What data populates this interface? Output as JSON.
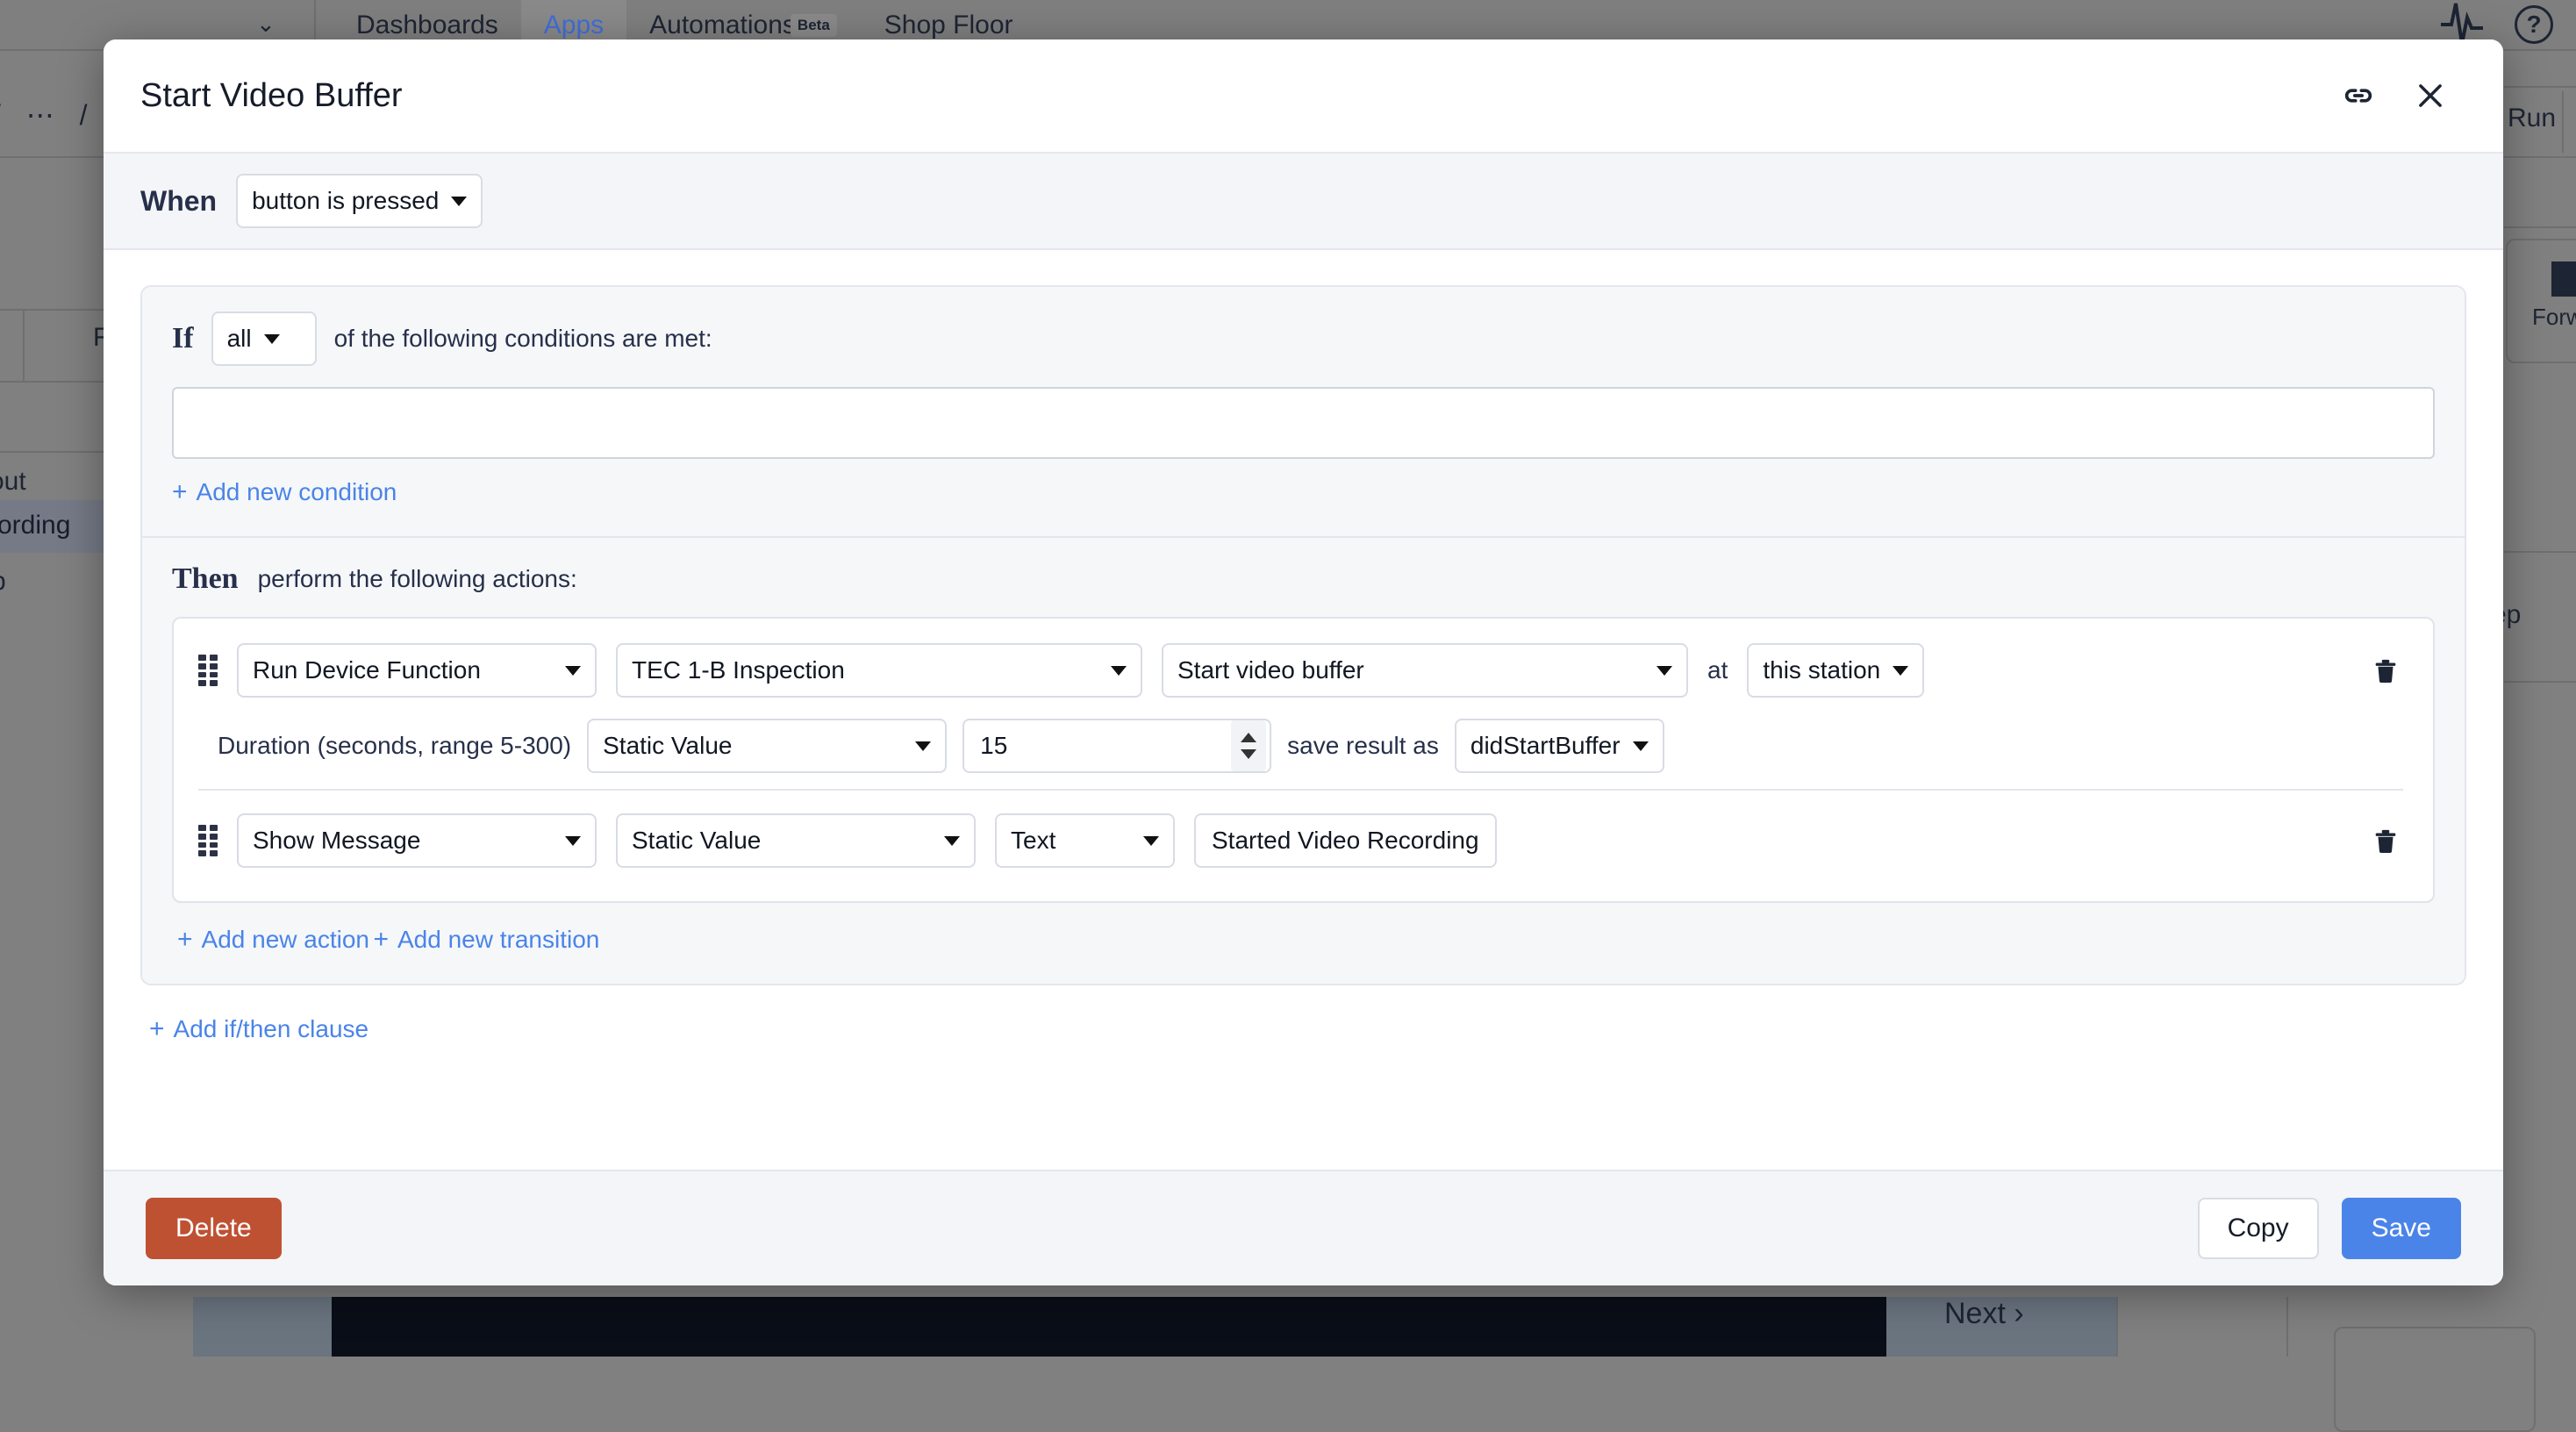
{
  "background": {
    "nav": {
      "chevron": "⌄",
      "items": [
        {
          "label": "Dashboards",
          "selected": false
        },
        {
          "label": "Apps",
          "selected": true
        },
        {
          "label": "Automations",
          "selected": false,
          "badge": "Beta"
        },
        {
          "label": "Shop Floor",
          "selected": false
        }
      ],
      "pulse_icon": "activity-icon",
      "help_icon": "?"
    },
    "breadcrumb": "/ ⋯ /",
    "run_button": "Run",
    "forward_label": "Forw",
    "step_label": "ep",
    "r_label": "R",
    "out_label": "out",
    "recording_label": "cording",
    "p_label": "p",
    "next_label": "Next ›"
  },
  "modal": {
    "title": "Start Video Buffer",
    "header_icons": [
      {
        "name": "link-icon"
      },
      {
        "name": "close-icon"
      }
    ],
    "when": {
      "label": "When",
      "trigger": "button is pressed"
    },
    "clause": {
      "if": {
        "keyword": "If",
        "match": "all",
        "description": "of the following conditions are met:",
        "conditions": [],
        "add_condition": "Add new condition"
      },
      "then": {
        "keyword": "Then",
        "description": "perform the following actions:",
        "actions": [
          {
            "type": "Run Device Function",
            "target": "TEC 1-B Inspection",
            "function": "Start video buffer",
            "at_label": "at",
            "station": "this station",
            "param_label": "Duration (seconds, range 5-300)",
            "param_mode": "Static Value",
            "param_value": "15",
            "save_label": "save result as",
            "save_variable": "didStartBuffer"
          },
          {
            "type": "Show Message",
            "value_mode": "Static Value",
            "content_type": "Text",
            "message": "Started Video Recording"
          }
        ],
        "add_action": "Add new action",
        "add_transition": "Add new transition"
      },
      "add_clause": "Add if/then clause"
    },
    "footer": {
      "delete": "Delete",
      "copy": "Copy",
      "save": "Save"
    }
  },
  "colors": {
    "accent_blue": "#4a84e8",
    "danger_red": "#bf5133",
    "text_dark": "#161c29",
    "panel_bg": "#f5f7f9"
  }
}
